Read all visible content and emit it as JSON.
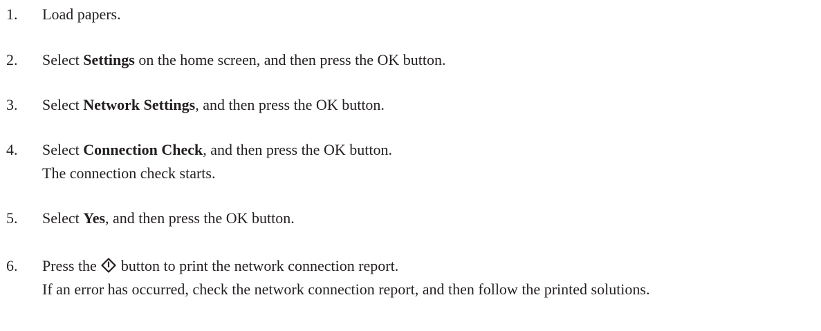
{
  "steps": [
    {
      "number": "1.",
      "parts": {
        "pre": "Load papers."
      }
    },
    {
      "number": "2.",
      "parts": {
        "pre": "Select ",
        "bold": "Settings",
        "post": " on the home screen, and then press the OK button."
      }
    },
    {
      "number": "3.",
      "parts": {
        "pre": "Select ",
        "bold": "Network Settings",
        "post": ", and then press the OK button."
      }
    },
    {
      "number": "4.",
      "parts": {
        "pre": "Select ",
        "bold": "Connection Check",
        "post": ", and then press the OK button."
      },
      "note": "The connection check starts."
    },
    {
      "number": "5.",
      "parts": {
        "pre": "Select ",
        "bold": "Yes",
        "post": ", and then press the OK button."
      }
    },
    {
      "number": "6.",
      "parts": {
        "pre": "Press the ",
        "icon": "start-button-icon",
        "post": " button to print the network connection report."
      },
      "note": "If an error has occurred, check the network connection report, and then follow the printed solutions."
    }
  ]
}
